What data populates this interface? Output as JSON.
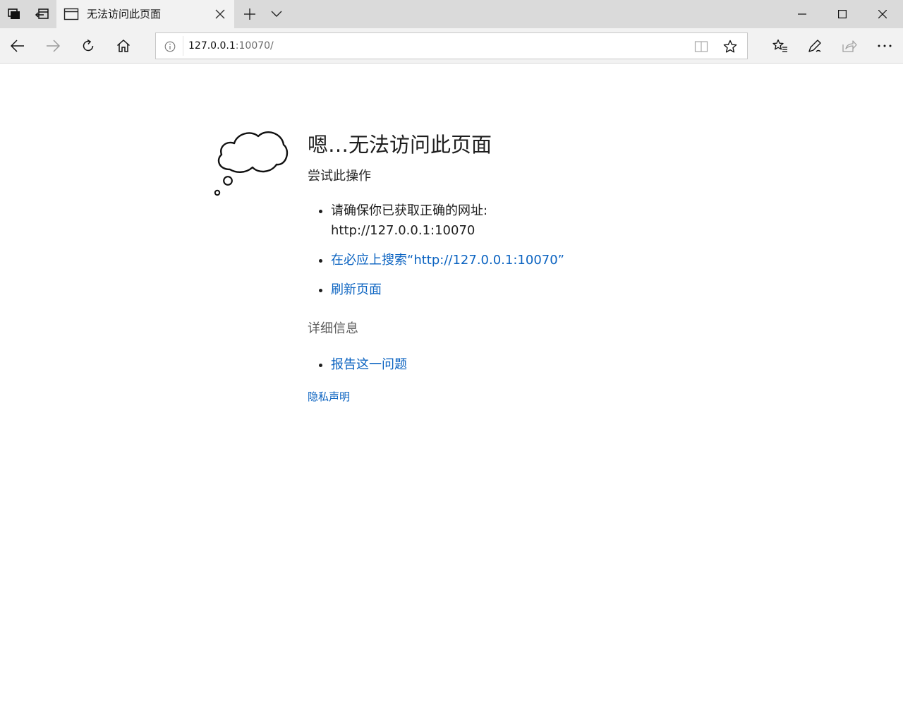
{
  "browser": {
    "tab": {
      "title": "无法访问此页面"
    },
    "address": {
      "host": "127.0.0.1",
      "rest": ":10070/"
    }
  },
  "page": {
    "heading": "嗯…无法访问此页面",
    "subheading": "尝试此操作",
    "tries": {
      "check_url_label": "请确保你已获取正确的网址:",
      "check_url_value": "http://127.0.0.1:10070",
      "search_link": "在必应上搜索“http://127.0.0.1:10070”",
      "refresh_link": "刷新页面"
    },
    "details_heading": "详细信息",
    "report_link": "报告这一问题",
    "privacy_link": "隐私声明"
  },
  "colors": {
    "link": "#0b63c1",
    "titlebar_bg": "#dadada",
    "toolbar_bg": "#f2f2f2"
  },
  "icons": {
    "tabbar": [
      "tab-manager-icon",
      "set-aside-tabs-icon",
      "page-icon",
      "close-icon",
      "new-tab-plus-icon",
      "tab-preview-chevron-icon"
    ],
    "window": [
      "minimize-icon",
      "maximize-icon",
      "window-close-icon"
    ],
    "nav": [
      "back-arrow-icon",
      "forward-arrow-icon",
      "refresh-icon",
      "home-icon",
      "info-icon",
      "reading-view-icon",
      "favorite-star-icon",
      "favorites-hub-icon",
      "pen-icon",
      "share-icon",
      "more-icon"
    ],
    "content": [
      "thought-cloud-icon"
    ]
  }
}
